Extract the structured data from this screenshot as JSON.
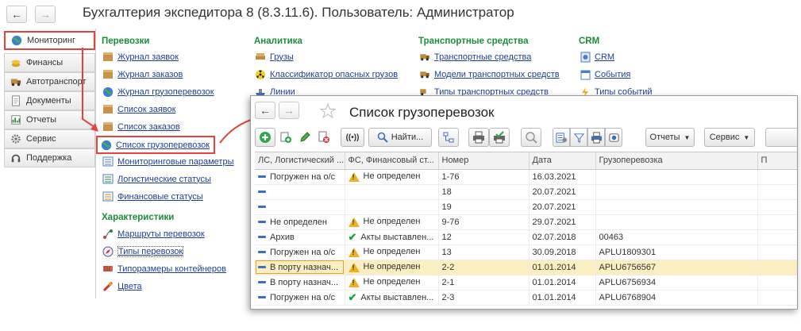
{
  "app": {
    "title": "Бухгалтерия экспедитора 8 (8.3.11.6). Пользователь: Администратор",
    "back": "←",
    "forward": "→"
  },
  "sidebar": {
    "items": [
      {
        "label": "Мониторинг",
        "icon": "globe-icon",
        "active": true
      },
      {
        "label": "Финансы",
        "icon": "coins-icon"
      },
      {
        "label": "Автотранспорт",
        "icon": "truck-icon"
      },
      {
        "label": "Документы",
        "icon": "document-icon"
      },
      {
        "label": "Отчеты",
        "icon": "chart-icon"
      },
      {
        "label": "Сервис",
        "icon": "gear-icon"
      },
      {
        "label": "Поддержка",
        "icon": "headset-icon"
      }
    ]
  },
  "sections": {
    "perevozki": {
      "title": "Перевозки",
      "items": [
        "Журнал заявок",
        "Журнал заказов",
        "Журнал грузоперевозок",
        "Список заявок",
        "Список заказов",
        "Список грузоперевозок",
        "Мониторинговые параметры",
        "Логистические статусы",
        "Финансовые статусы"
      ]
    },
    "harakteristiki": {
      "title": "Характеристики",
      "items": [
        "Маршруты перевозок",
        "Типы перевозок",
        "Типоразмеры контейнеров",
        "Цвета"
      ]
    },
    "analitika": {
      "title": "Аналитика",
      "items": [
        "Грузы",
        "Классификатор опасных грузов",
        "Линии"
      ]
    },
    "transport": {
      "title": "Транспортные средства",
      "items": [
        "Транспортные средства",
        "Модели транспортных средств",
        "Типы транспортных средств"
      ]
    },
    "crm": {
      "title": "CRM",
      "items": [
        "CRM",
        "События",
        "Типы событий"
      ]
    }
  },
  "popup": {
    "title": "Список грузоперевозок",
    "toolbar": {
      "find": "Найти...",
      "reports": "Отчеты",
      "service": "Сервис",
      "broadcast": "((•))"
    },
    "columns": [
      "ЛС, Логистический ...",
      "ФС, Финансовый ст...",
      "Номер",
      "Дата",
      "Грузоперевозка",
      "П"
    ],
    "rows": [
      {
        "ls": "Погружен на о/с",
        "ls_icon": "dash",
        "fs": "Не определен",
        "fs_icon": "warn",
        "num": "1-76",
        "date": "16.03.2021",
        "cargo": ""
      },
      {
        "ls": "",
        "ls_icon": "dash",
        "fs": "",
        "fs_icon": "",
        "num": "18",
        "date": "20.07.2021",
        "cargo": ""
      },
      {
        "ls": "",
        "ls_icon": "dash",
        "fs": "",
        "fs_icon": "",
        "num": "19",
        "date": "20.07.2021",
        "cargo": ""
      },
      {
        "ls": "Не определен",
        "ls_icon": "dash",
        "fs": "Не определен",
        "fs_icon": "warn",
        "num": "9-76",
        "date": "29.07.2021",
        "cargo": ""
      },
      {
        "ls": "Архив",
        "ls_icon": "dash",
        "fs": "Акты выставлен...",
        "fs_icon": "check",
        "num": "12",
        "date": "02.07.2018",
        "cargo": "00463"
      },
      {
        "ls": "Погружен на о/с",
        "ls_icon": "dash",
        "fs": "Не определен",
        "fs_icon": "warn",
        "num": "13",
        "date": "30.09.2018",
        "cargo": "APLU1809301"
      },
      {
        "ls": "В порту назнач...",
        "ls_icon": "dash",
        "fs": "Не определен",
        "fs_icon": "warn",
        "num": "2-2",
        "date": "01.01.2014",
        "cargo": "APLU6756567",
        "selected": true
      },
      {
        "ls": "В порту назнач...",
        "ls_icon": "dash",
        "fs": "Не определен",
        "fs_icon": "warn",
        "num": "2-1",
        "date": "01.01.2014",
        "cargo": "APLU6756934"
      },
      {
        "ls": "Погружен на о/с",
        "ls_icon": "dash",
        "fs": "Акты выставлен...",
        "fs_icon": "check",
        "num": "2-3",
        "date": "01.01.2014",
        "cargo": "APLU6768904"
      }
    ]
  },
  "colors": {
    "accent_red": "#e4443b",
    "section_green": "#1a8f3a",
    "link_blue": "#1d3f9a"
  }
}
